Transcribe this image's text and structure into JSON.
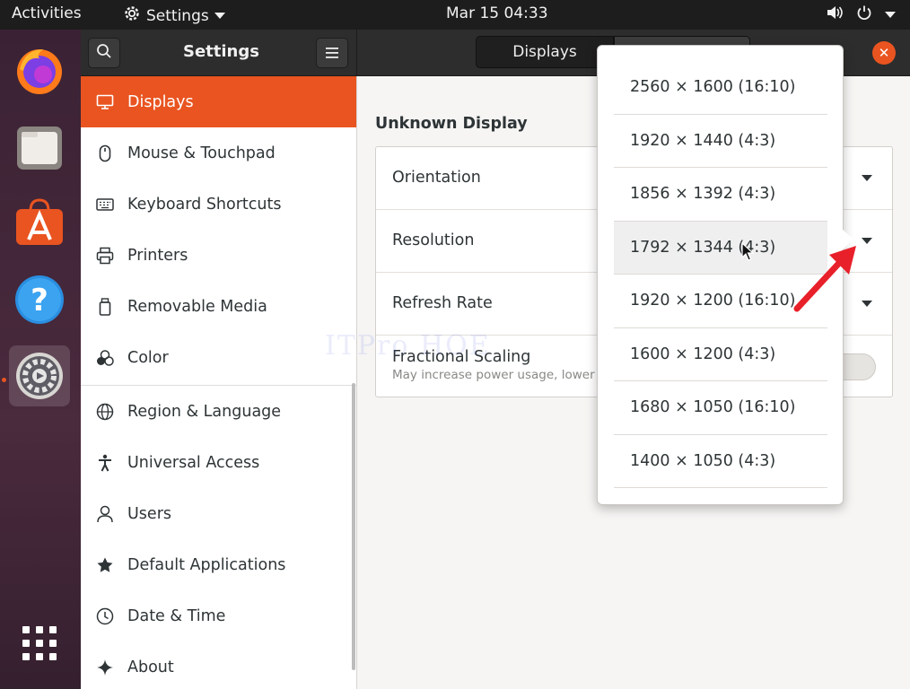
{
  "topbar": {
    "activities": "Activities",
    "app_menu": "Settings",
    "clock": "Mar 15  04:33"
  },
  "dock": {
    "items": [
      "firefox-icon",
      "files-icon",
      "software-icon",
      "help-icon",
      "settings-icon",
      "app-grid-icon"
    ]
  },
  "headerbar": {
    "title": "Settings",
    "tabs": [
      "Displays",
      ""
    ]
  },
  "sidebar": {
    "items": [
      {
        "label": "Displays",
        "icon": "display-icon"
      },
      {
        "label": "Mouse & Touchpad",
        "icon": "mouse-icon"
      },
      {
        "label": "Keyboard Shortcuts",
        "icon": "keyboard-icon"
      },
      {
        "label": "Printers",
        "icon": "printer-icon"
      },
      {
        "label": "Removable Media",
        "icon": "removable-media-icon"
      },
      {
        "label": "Color",
        "icon": "color-icon"
      },
      {
        "label": "Region & Language",
        "icon": "globe-icon"
      },
      {
        "label": "Universal Access",
        "icon": "accessibility-icon"
      },
      {
        "label": "Users",
        "icon": "user-icon"
      },
      {
        "label": "Default Applications",
        "icon": "star-icon"
      },
      {
        "label": "Date & Time",
        "icon": "clock-icon"
      },
      {
        "label": "About",
        "icon": "about-icon"
      }
    ]
  },
  "content": {
    "section_title": "Unknown Display",
    "rows": {
      "orientation": "Orientation",
      "resolution": "Resolution",
      "refresh_rate": "Refresh Rate",
      "fractional_scaling": "Fractional Scaling",
      "fractional_scaling_sub": "May increase power usage, lower"
    },
    "watermark": "ITPro HOE"
  },
  "resolution_dropdown": {
    "options": [
      "2560 × 1600 (16:10)",
      "1920 × 1440 (4:3)",
      "1856 × 1392 (4:3)",
      "1792 × 1344 (4:3)",
      "1920 × 1200 (16:10)",
      "1600 × 1200 (4:3)",
      "1680 × 1050 (16:10)",
      "1400 × 1050 (4:3)"
    ],
    "hovered_index": 3
  },
  "colors": {
    "accent": "#e95420",
    "annotation_arrow": "#e8202a"
  }
}
